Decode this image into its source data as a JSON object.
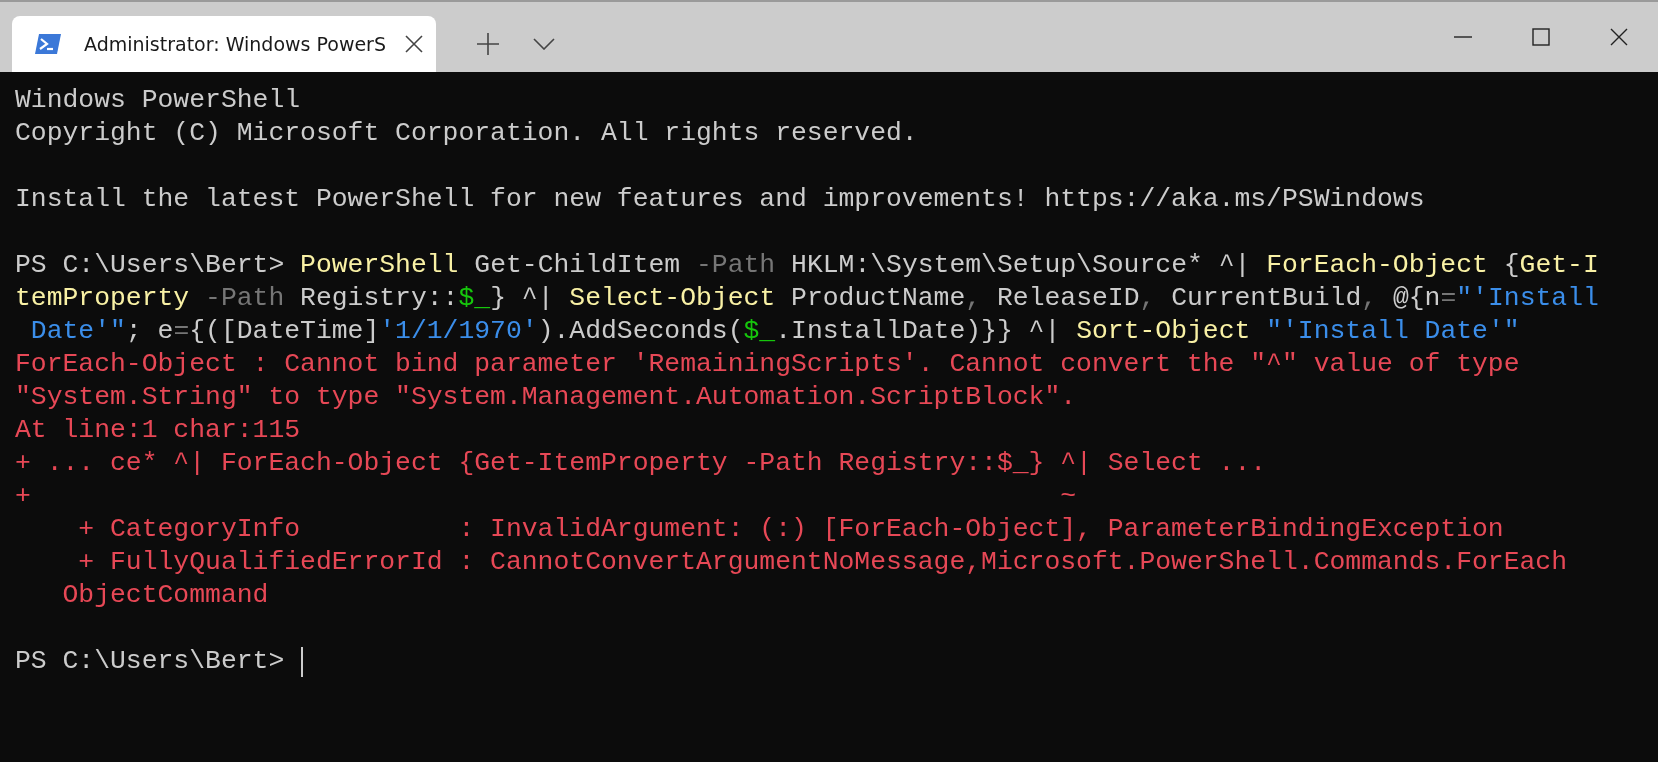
{
  "window": {
    "tab": {
      "title": "Administrator: Windows PowerS",
      "selected": true
    }
  },
  "terminal": {
    "lines": [
      {
        "kind": "text",
        "segments": [
          {
            "kind": "plain",
            "text": "Windows PowerShell"
          }
        ]
      },
      {
        "kind": "text",
        "segments": [
          {
            "kind": "plain",
            "text": "Copyright (C) Microsoft Corporation. All rights reserved."
          }
        ]
      },
      {
        "kind": "blank"
      },
      {
        "kind": "text",
        "segments": [
          {
            "kind": "plain",
            "text": "Install the latest PowerShell for new features and improvements! https://aka.ms/PSWindows"
          }
        ]
      },
      {
        "kind": "blank"
      },
      {
        "kind": "text",
        "segments": [
          {
            "kind": "plain",
            "text": "PS C:\\Users\\Bert> "
          },
          {
            "kind": "command",
            "text": "PowerShell"
          },
          {
            "kind": "plain",
            "text": " Get-ChildItem "
          },
          {
            "kind": "parameter",
            "text": "-Path"
          },
          {
            "kind": "plain",
            "text": " HKLM:\\System\\Setup\\Source* ^| "
          },
          {
            "kind": "command",
            "text": "ForEach-Object"
          },
          {
            "kind": "plain",
            "text": " {"
          },
          {
            "kind": "command",
            "text": "Get-I"
          }
        ]
      },
      {
        "kind": "text",
        "segments": [
          {
            "kind": "command",
            "text": "temProperty"
          },
          {
            "kind": "parameter",
            "text": " -Path"
          },
          {
            "kind": "plain",
            "text": " Registry::"
          },
          {
            "kind": "variable",
            "text": "$_"
          },
          {
            "kind": "plain",
            "text": "} ^| "
          },
          {
            "kind": "command",
            "text": "Select-Object"
          },
          {
            "kind": "plain",
            "text": " ProductName"
          },
          {
            "kind": "operator",
            "text": ","
          },
          {
            "kind": "plain",
            "text": " ReleaseID"
          },
          {
            "kind": "operator",
            "text": ","
          },
          {
            "kind": "plain",
            "text": " CurrentBuild"
          },
          {
            "kind": "operator",
            "text": ","
          },
          {
            "kind": "plain",
            "text": " @{n"
          },
          {
            "kind": "operator",
            "text": "="
          },
          {
            "kind": "string",
            "text": "\"'Install"
          }
        ]
      },
      {
        "kind": "text",
        "segments": [
          {
            "kind": "string",
            "text": " Date'\""
          },
          {
            "kind": "plain",
            "text": "; e"
          },
          {
            "kind": "operator",
            "text": "="
          },
          {
            "kind": "plain",
            "text": "{([DateTime]"
          },
          {
            "kind": "string",
            "text": "'1/1/1970'"
          },
          {
            "kind": "plain",
            "text": ").AddSeconds("
          },
          {
            "kind": "variable",
            "text": "$_"
          },
          {
            "kind": "plain",
            "text": ".InstallDate)}} ^| "
          },
          {
            "kind": "command",
            "text": "Sort-Object"
          },
          {
            "kind": "string",
            "text": " \"'Install Date'\""
          }
        ]
      },
      {
        "kind": "text",
        "segments": [
          {
            "kind": "error",
            "text": "ForEach-Object : Cannot bind parameter 'RemainingScripts'. Cannot convert the \"^\" value of type"
          }
        ]
      },
      {
        "kind": "text",
        "segments": [
          {
            "kind": "error",
            "text": "\"System.String\" to type \"System.Management.Automation.ScriptBlock\"."
          }
        ]
      },
      {
        "kind": "text",
        "segments": [
          {
            "kind": "error",
            "text": "At line:1 char:115"
          }
        ]
      },
      {
        "kind": "text",
        "segments": [
          {
            "kind": "error",
            "text": "+ ... ce* ^| ForEach-Object {Get-ItemProperty -Path Registry::$_} ^| Select ..."
          }
        ]
      },
      {
        "kind": "text",
        "segments": [
          {
            "kind": "error",
            "text": "+                                                                 ~"
          }
        ]
      },
      {
        "kind": "text",
        "segments": [
          {
            "kind": "error",
            "text": "    + CategoryInfo          : InvalidArgument: (:) [ForEach-Object], ParameterBindingException"
          }
        ]
      },
      {
        "kind": "text",
        "segments": [
          {
            "kind": "error",
            "text": "    + FullyQualifiedErrorId : CannotConvertArgumentNoMessage,Microsoft.PowerShell.Commands.ForEach"
          }
        ]
      },
      {
        "kind": "text",
        "segments": [
          {
            "kind": "error",
            "text": "   ObjectCommand"
          }
        ]
      },
      {
        "kind": "blank"
      },
      {
        "kind": "text",
        "cursor": true,
        "segments": [
          {
            "kind": "plain",
            "text": "PS C:\\Users\\Bert> "
          }
        ]
      }
    ]
  }
}
